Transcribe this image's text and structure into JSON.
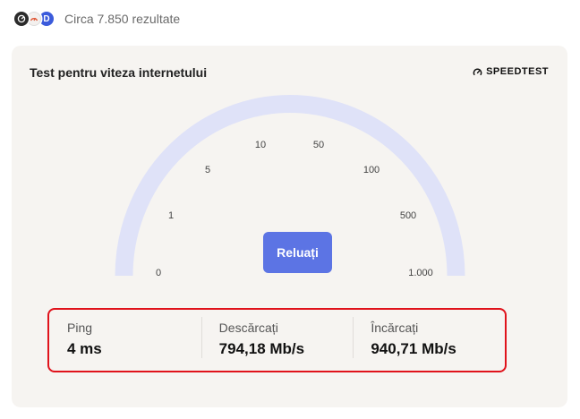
{
  "header": {
    "result_count": "Circa 7.850 rezultate",
    "icons": [
      "speedometer-icon",
      "gauge-icon",
      "d-icon"
    ],
    "d_icon_letter": "D"
  },
  "card": {
    "title": "Test pentru viteza internetului",
    "brand": "SPEEDTEST"
  },
  "gauge": {
    "labels": [
      "0",
      "1",
      "5",
      "10",
      "50",
      "100",
      "500",
      "1.000"
    ],
    "arc_color": "#dfe2f8"
  },
  "rerun_button": "Reluați",
  "results": [
    {
      "label": "Ping",
      "value": "4 ms"
    },
    {
      "label": "Descărcați",
      "value": "794,18 Mb/s"
    },
    {
      "label": "Încărcați",
      "value": "940,71 Mb/s"
    }
  ],
  "colors": {
    "accent": "#5c74e4",
    "highlight": "#e0121b",
    "card_bg": "#f6f4f1"
  }
}
